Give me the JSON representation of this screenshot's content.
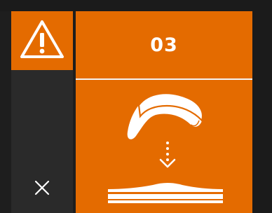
{
  "dialog": {
    "step_number": "03",
    "warning_icon": "warning-triangle-icon",
    "close_icon": "close-x-icon",
    "illustration": "place-insole-on-base-illustration"
  },
  "colors": {
    "accent": "#e46b00",
    "background": "#1e1e1e",
    "side_strip": "#2a2a2a",
    "foreground": "#ffffff"
  }
}
